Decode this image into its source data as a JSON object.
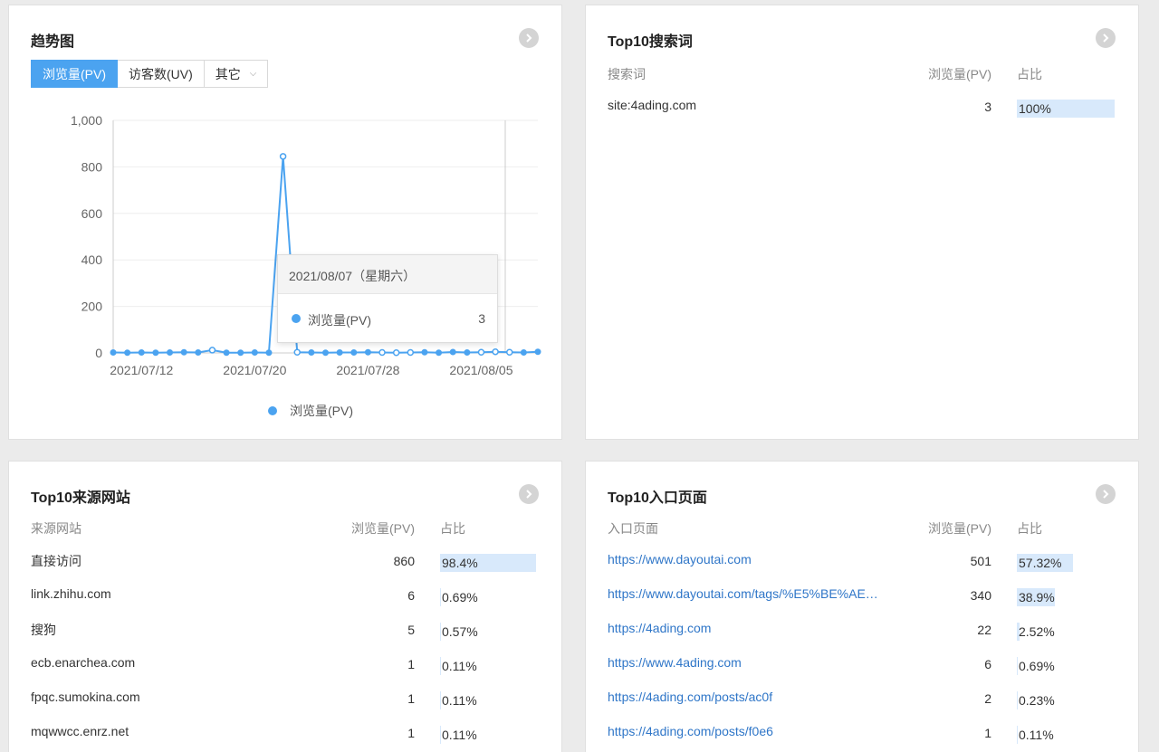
{
  "trend": {
    "title": "趋势图",
    "tabs": [
      {
        "label": "浏览量(PV)",
        "active": true
      },
      {
        "label": "访客数(UV)",
        "active": false
      },
      {
        "label": "其它",
        "active": false
      }
    ],
    "tooltip": {
      "date": "2021/08/07（星期六）",
      "series": "浏览量(PV)",
      "value": "3"
    },
    "legend": "浏览量(PV)"
  },
  "chart_data": {
    "type": "line",
    "ylim": [
      0,
      1000
    ],
    "yticks": [
      "0",
      "200",
      "400",
      "600",
      "800",
      "1,000"
    ],
    "xticks": [
      "2021/07/12",
      "2021/07/20",
      "2021/07/28",
      "2021/08/05"
    ],
    "x": [
      "2021/07/10",
      "2021/07/11",
      "2021/07/12",
      "2021/07/13",
      "2021/07/14",
      "2021/07/15",
      "2021/07/16",
      "2021/07/17",
      "2021/07/18",
      "2021/07/19",
      "2021/07/20",
      "2021/07/21",
      "2021/07/22",
      "2021/07/23",
      "2021/07/24",
      "2021/07/25",
      "2021/07/26",
      "2021/07/27",
      "2021/07/28",
      "2021/07/29",
      "2021/07/30",
      "2021/07/31",
      "2021/08/01",
      "2021/08/02",
      "2021/08/03",
      "2021/08/04",
      "2021/08/05",
      "2021/08/06",
      "2021/08/07",
      "2021/08/08",
      "2021/08/09"
    ],
    "series": [
      {
        "name": "浏览量(PV)",
        "color": "#4ba3f0",
        "values": [
          2,
          1,
          2,
          1,
          2,
          3,
          2,
          12,
          1,
          1,
          2,
          1,
          845,
          3,
          2,
          1,
          2,
          2,
          3,
          2,
          1,
          2,
          3,
          1,
          4,
          2,
          3,
          5,
          3,
          2,
          5
        ]
      }
    ]
  },
  "search": {
    "title": "Top10搜索词",
    "headers": {
      "name": "搜索词",
      "pv": "浏览量(PV)",
      "pct": "占比"
    },
    "rows": [
      {
        "name": "site:4ading.com",
        "pv": "3",
        "pct": "100%",
        "share": 100
      }
    ]
  },
  "sources": {
    "title": "Top10来源网站",
    "headers": {
      "name": "来源网站",
      "pv": "浏览量(PV)",
      "pct": "占比"
    },
    "rows": [
      {
        "name": "直接访问",
        "pv": "860",
        "pct": "98.4%",
        "share": 98.4
      },
      {
        "name": "link.zhihu.com",
        "pv": "6",
        "pct": "0.69%",
        "share": 0.69
      },
      {
        "name": "搜狗",
        "pv": "5",
        "pct": "0.57%",
        "share": 0.57
      },
      {
        "name": "ecb.enarchea.com",
        "pv": "1",
        "pct": "0.11%",
        "share": 0.11
      },
      {
        "name": "fpqc.sumokina.com",
        "pv": "1",
        "pct": "0.11%",
        "share": 0.11
      },
      {
        "name": "mqwwcc.enrz.net",
        "pv": "1",
        "pct": "0.11%",
        "share": 0.11
      }
    ]
  },
  "entry": {
    "title": "Top10入口页面",
    "headers": {
      "name": "入口页面",
      "pv": "浏览量(PV)",
      "pct": "占比"
    },
    "rows": [
      {
        "name": "https://www.dayoutai.com",
        "pv": "501",
        "pct": "57.32%",
        "share": 57.32
      },
      {
        "name": "https://www.dayoutai.com/tags/%E5%BE%AE…",
        "pv": "340",
        "pct": "38.9%",
        "share": 38.9
      },
      {
        "name": "https://4ading.com",
        "pv": "22",
        "pct": "2.52%",
        "share": 2.52
      },
      {
        "name": "https://www.4ading.com",
        "pv": "6",
        "pct": "0.69%",
        "share": 0.69
      },
      {
        "name": "https://4ading.com/posts/ac0f",
        "pv": "2",
        "pct": "0.23%",
        "share": 0.23
      },
      {
        "name": "https://4ading.com/posts/f0e6",
        "pv": "1",
        "pct": "0.11%",
        "share": 0.11
      }
    ]
  }
}
